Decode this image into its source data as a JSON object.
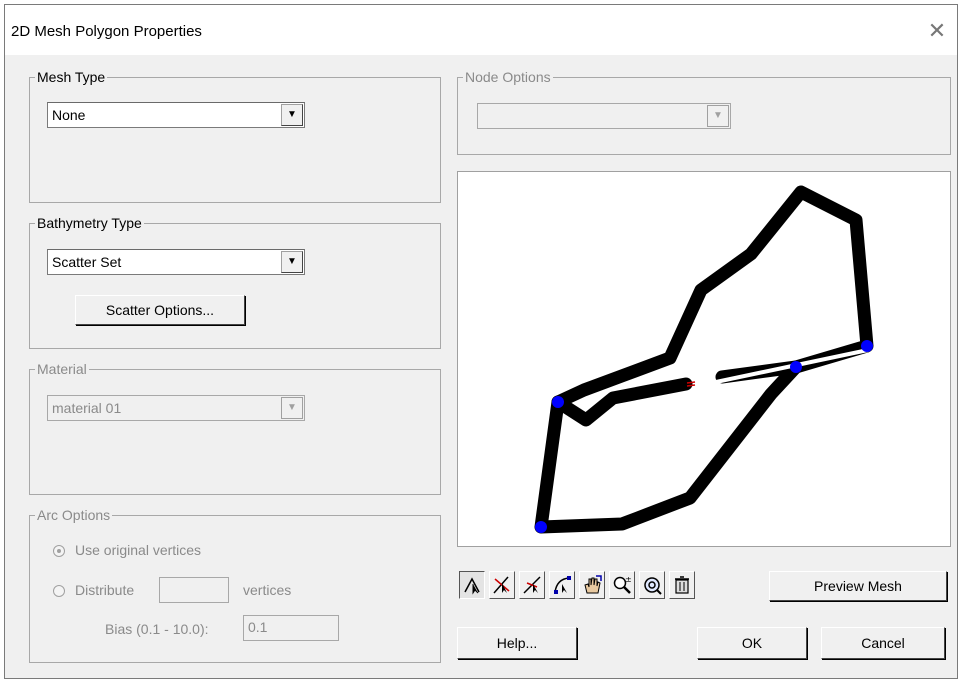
{
  "window": {
    "title": "2D Mesh Polygon Properties",
    "close_icon": "close-icon"
  },
  "mesh_type": {
    "legend": "Mesh Type",
    "selected": "None"
  },
  "bathymetry_type": {
    "legend": "Bathymetry Type",
    "selected": "Scatter Set",
    "options_button": "Scatter Options..."
  },
  "material": {
    "legend": "Material",
    "selected": "material 01"
  },
  "arc_options": {
    "legend": "Arc Options",
    "use_original_label": "Use original vertices",
    "use_original_checked": true,
    "distribute_label": "Distribute",
    "distribute_value": "",
    "vertices_label": "vertices",
    "bias_label": "Bias (0.1 - 10.0):",
    "bias_value": "0.1"
  },
  "node_options": {
    "legend": "Node Options",
    "selected": ""
  },
  "toolbar": {
    "tools": [
      "select-tool-icon",
      "select-vertex-icon",
      "select-arc-icon",
      "create-arc-icon",
      "pan-icon",
      "zoom-icon",
      "frame-icon",
      "delete-icon"
    ],
    "preview_mesh": "Preview Mesh"
  },
  "buttons": {
    "help": "Help...",
    "ok": "OK",
    "cancel": "Cancel"
  },
  "colors": {
    "arc": "#000000",
    "node": "#0000ff",
    "accent": "#cc0000"
  }
}
